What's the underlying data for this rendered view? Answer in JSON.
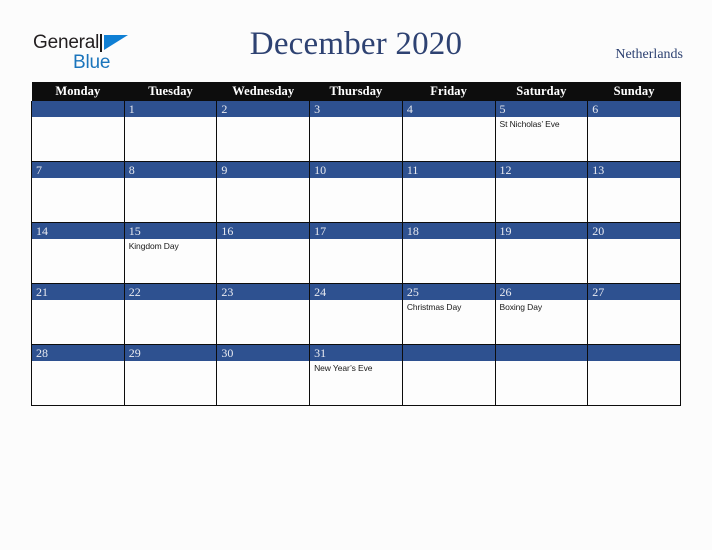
{
  "brand": {
    "name_top": "General",
    "name_bottom": "Blue",
    "mark": "triangle-icon",
    "color_top": "#231f20",
    "color_bottom": "#1b75bc",
    "mark_color": "#0f7fd4"
  },
  "header": {
    "title": "December 2020",
    "region": "Netherlands",
    "title_color": "#2e4272"
  },
  "calendar": {
    "weekday_headers": [
      "Monday",
      "Tuesday",
      "Wednesday",
      "Thursday",
      "Friday",
      "Saturday",
      "Sunday"
    ],
    "header_bg": "#0d0d0d",
    "daybar_bg": "#2e5190",
    "cell_bg": "#fdfdfd",
    "weeks": [
      [
        {
          "date": "",
          "events": []
        },
        {
          "date": "1",
          "events": []
        },
        {
          "date": "2",
          "events": []
        },
        {
          "date": "3",
          "events": []
        },
        {
          "date": "4",
          "events": []
        },
        {
          "date": "5",
          "events": [
            "St Nicholas’ Eve"
          ]
        },
        {
          "date": "6",
          "events": []
        }
      ],
      [
        {
          "date": "7",
          "events": []
        },
        {
          "date": "8",
          "events": []
        },
        {
          "date": "9",
          "events": []
        },
        {
          "date": "10",
          "events": []
        },
        {
          "date": "11",
          "events": []
        },
        {
          "date": "12",
          "events": []
        },
        {
          "date": "13",
          "events": []
        }
      ],
      [
        {
          "date": "14",
          "events": []
        },
        {
          "date": "15",
          "events": [
            "Kingdom Day"
          ]
        },
        {
          "date": "16",
          "events": []
        },
        {
          "date": "17",
          "events": []
        },
        {
          "date": "18",
          "events": []
        },
        {
          "date": "19",
          "events": []
        },
        {
          "date": "20",
          "events": []
        }
      ],
      [
        {
          "date": "21",
          "events": []
        },
        {
          "date": "22",
          "events": []
        },
        {
          "date": "23",
          "events": []
        },
        {
          "date": "24",
          "events": []
        },
        {
          "date": "25",
          "events": [
            "Christmas Day"
          ]
        },
        {
          "date": "26",
          "events": [
            "Boxing Day"
          ]
        },
        {
          "date": "27",
          "events": []
        }
      ],
      [
        {
          "date": "28",
          "events": []
        },
        {
          "date": "29",
          "events": []
        },
        {
          "date": "30",
          "events": []
        },
        {
          "date": "31",
          "events": [
            "New Year’s Eve"
          ]
        },
        {
          "date": "",
          "events": []
        },
        {
          "date": "",
          "events": []
        },
        {
          "date": "",
          "events": []
        }
      ]
    ]
  }
}
